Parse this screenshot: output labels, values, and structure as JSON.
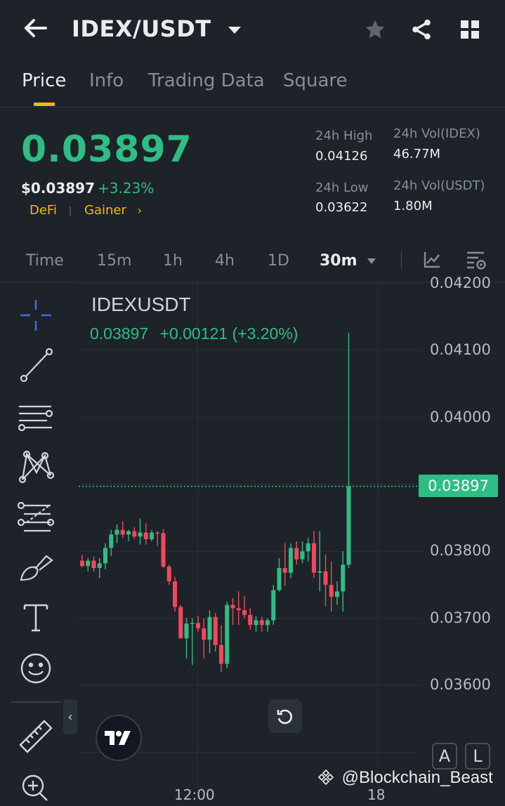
{
  "header": {
    "title": "IDEX/USDT",
    "tabs": [
      "Price",
      "Info",
      "Trading Data",
      "Square"
    ]
  },
  "ticker": {
    "last_price": "0.03897",
    "usd_price": "$0.03897",
    "change_pct": "+3.23%",
    "tags": [
      "DeFi",
      "Gainer"
    ],
    "high_label": "24h High",
    "high": "0.04126",
    "low_label": "24h Low",
    "low": "0.03622",
    "vol_base_label": "24h Vol(IDEX)",
    "vol_base": "46.77M",
    "vol_quote_label": "24h Vol(USDT)",
    "vol_quote": "1.80M"
  },
  "intervals": {
    "items": [
      "Time",
      "15m",
      "1h",
      "4h",
      "1D"
    ],
    "selected": "30m"
  },
  "chart": {
    "symbol": "IDEXUSDT",
    "ohlc_price": "0.03897",
    "ohlc_change": "+0.00121 (+3.20%)",
    "current_price_label": "0.03897",
    "axis_labels": [
      "0.04200",
      "0.04100",
      "0.04000",
      "0.03800",
      "0.03700",
      "0.03600"
    ],
    "x_labels": [
      "12:00",
      "18"
    ],
    "up_color": "#2ebd85",
    "down_color": "#f6465d"
  },
  "chart_data": {
    "type": "candlestick",
    "title": "IDEXUSDT",
    "interval": "30m",
    "y_ticks": [
      0.042,
      0.041,
      0.04,
      0.038,
      0.037,
      0.036
    ],
    "x_ticks": [
      "12:00",
      "18"
    ],
    "current_price": 0.03897,
    "candles": [
      [
        0.03786,
        0.03795,
        0.03776,
        0.03778
      ],
      [
        0.03778,
        0.0379,
        0.0377,
        0.03786
      ],
      [
        0.03786,
        0.03792,
        0.0377,
        0.03775
      ],
      [
        0.03775,
        0.0379,
        0.0376,
        0.03782
      ],
      [
        0.03782,
        0.03812,
        0.03773,
        0.03805
      ],
      [
        0.03805,
        0.03832,
        0.03793,
        0.03825
      ],
      [
        0.03825,
        0.0384,
        0.03812,
        0.03832
      ],
      [
        0.03832,
        0.03845,
        0.0382,
        0.03825
      ],
      [
        0.03825,
        0.03832,
        0.03815,
        0.0383
      ],
      [
        0.0383,
        0.03836,
        0.03818,
        0.03822
      ],
      [
        0.03822,
        0.03849,
        0.0381,
        0.03828
      ],
      [
        0.03828,
        0.03842,
        0.0381,
        0.03818
      ],
      [
        0.03818,
        0.03832,
        0.03815,
        0.03828
      ],
      [
        0.03828,
        0.0383,
        0.03808,
        0.03827
      ],
      [
        0.03827,
        0.03833,
        0.03775,
        0.03777
      ],
      [
        0.03777,
        0.0378,
        0.0375,
        0.03755
      ],
      [
        0.03755,
        0.03762,
        0.0371,
        0.03717
      ],
      [
        0.03717,
        0.0372,
        0.0367,
        0.0367
      ],
      [
        0.0367,
        0.037,
        0.0364,
        0.03692
      ],
      [
        0.03692,
        0.037,
        0.0363,
        0.03693
      ],
      [
        0.03693,
        0.03703,
        0.0368,
        0.03685
      ],
      [
        0.03685,
        0.037,
        0.0364,
        0.03668
      ],
      [
        0.03668,
        0.03712,
        0.03648,
        0.03702
      ],
      [
        0.03702,
        0.03708,
        0.0365,
        0.0366
      ],
      [
        0.0366,
        0.0369,
        0.0362,
        0.03632
      ],
      [
        0.03632,
        0.03725,
        0.03625,
        0.0372
      ],
      [
        0.0372,
        0.0373,
        0.0369,
        0.03715
      ],
      [
        0.03715,
        0.0374,
        0.0369,
        0.03712
      ],
      [
        0.03712,
        0.03733,
        0.037,
        0.03705
      ],
      [
        0.03705,
        0.03715,
        0.03683,
        0.0369
      ],
      [
        0.0369,
        0.03703,
        0.0368,
        0.03697
      ],
      [
        0.03697,
        0.03702,
        0.0368,
        0.0369
      ],
      [
        0.0369,
        0.037,
        0.0368,
        0.03697
      ],
      [
        0.03697,
        0.0375,
        0.0369,
        0.03742
      ],
      [
        0.03742,
        0.0379,
        0.0374,
        0.03775
      ],
      [
        0.03775,
        0.03812,
        0.03748,
        0.03768
      ],
      [
        0.03768,
        0.03812,
        0.0376,
        0.03805
      ],
      [
        0.03805,
        0.03815,
        0.0378,
        0.03788
      ],
      [
        0.03788,
        0.03815,
        0.03782,
        0.038
      ],
      [
        0.038,
        0.0382,
        0.03785,
        0.03812
      ],
      [
        0.03812,
        0.0383,
        0.0376,
        0.03768
      ],
      [
        0.03768,
        0.0383,
        0.0374,
        0.0377
      ],
      [
        0.0377,
        0.03795,
        0.03718,
        0.0375
      ],
      [
        0.0375,
        0.03785,
        0.0371,
        0.03732
      ],
      [
        0.03732,
        0.03755,
        0.0372,
        0.0374
      ],
      [
        0.0374,
        0.038,
        0.0371,
        0.0378
      ],
      [
        0.0378,
        0.04126,
        0.03775,
        0.03897
      ]
    ]
  },
  "watermark": "@Blockchain_Beast",
  "buttons": {
    "auto": "A",
    "log": "L"
  }
}
